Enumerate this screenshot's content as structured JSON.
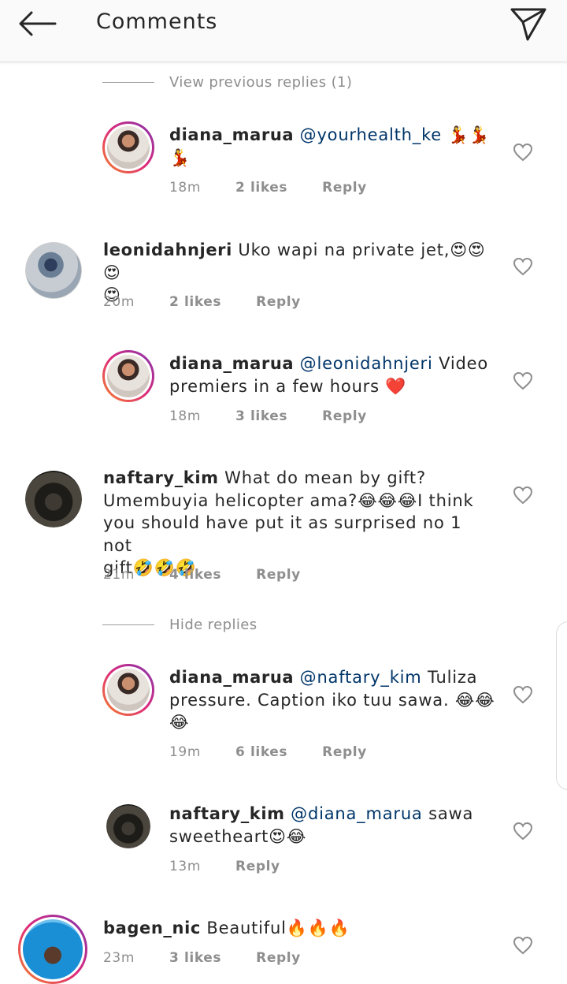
{
  "header": {
    "title": "Comments",
    "back_icon": "arrow-left-icon",
    "send_icon": "paper-plane-icon"
  },
  "toggles": {
    "view_previous": "View previous replies (1)",
    "hide": "Hide replies"
  },
  "comments": [
    {
      "username": "diana_marua",
      "mention": "@yourhealth_ke",
      "text_line1_emoji": "💃💃",
      "text_line2": "💃",
      "time": "18m",
      "likes": "2 likes",
      "reply": "Reply",
      "avatar": "diana"
    },
    {
      "username": "leonidahnjeri",
      "text": "Uko wapi na private jet,😍😍😍",
      "text_line2": "😍",
      "time": "20m",
      "likes": "2 likes",
      "reply": "Reply",
      "avatar": "leonida"
    },
    {
      "username": "diana_marua",
      "mention": "@leonidahnjeri",
      "text": "Video",
      "text_line2": "premiers in a few hours ❤️",
      "time": "18m",
      "likes": "3 likes",
      "reply": "Reply",
      "avatar": "diana"
    },
    {
      "username": "naftary_kim",
      "text": "What do mean by gift?",
      "text_line2": "Umembuyia helicopter ama?😂😂😂I think",
      "text_line3": "you should have put it as surprised no 1 not",
      "text_line4": "gift🤣🤣🤣",
      "time": "21m",
      "likes": "4 likes",
      "reply": "Reply",
      "avatar": "naftary"
    },
    {
      "username": "diana_marua",
      "mention": "@naftary_kim",
      "text": "Tuliza",
      "text_line2": "pressure. Caption iko tuu sawa. 😂😂",
      "text_line3": "😂",
      "time": "19m",
      "likes": "6 likes",
      "reply": "Reply",
      "avatar": "diana"
    },
    {
      "username": "naftary_kim",
      "mention": "@diana_marua",
      "text": "sawa",
      "text_line2": "sweetheart😍😂",
      "time": "13m",
      "reply": "Reply",
      "avatar": "naftary"
    },
    {
      "username": "bagen_nic",
      "text": "Beautiful🔥🔥🔥",
      "time": "23m",
      "likes": "3 likes",
      "reply": "Reply",
      "avatar": "bagen"
    }
  ],
  "colors": {
    "mention": "#003569",
    "meta": "#8e8e8e",
    "text": "#262626"
  }
}
